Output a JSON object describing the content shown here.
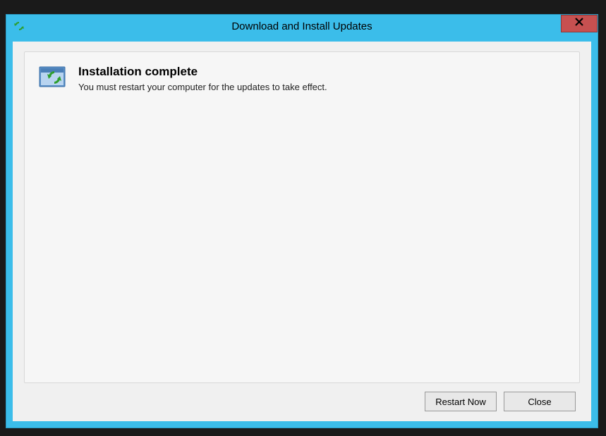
{
  "window": {
    "title": "Download and Install Updates"
  },
  "content": {
    "heading": "Installation complete",
    "body": "You must restart your computer for the updates to take effect."
  },
  "buttons": {
    "restart": "Restart Now",
    "close": "Close"
  }
}
